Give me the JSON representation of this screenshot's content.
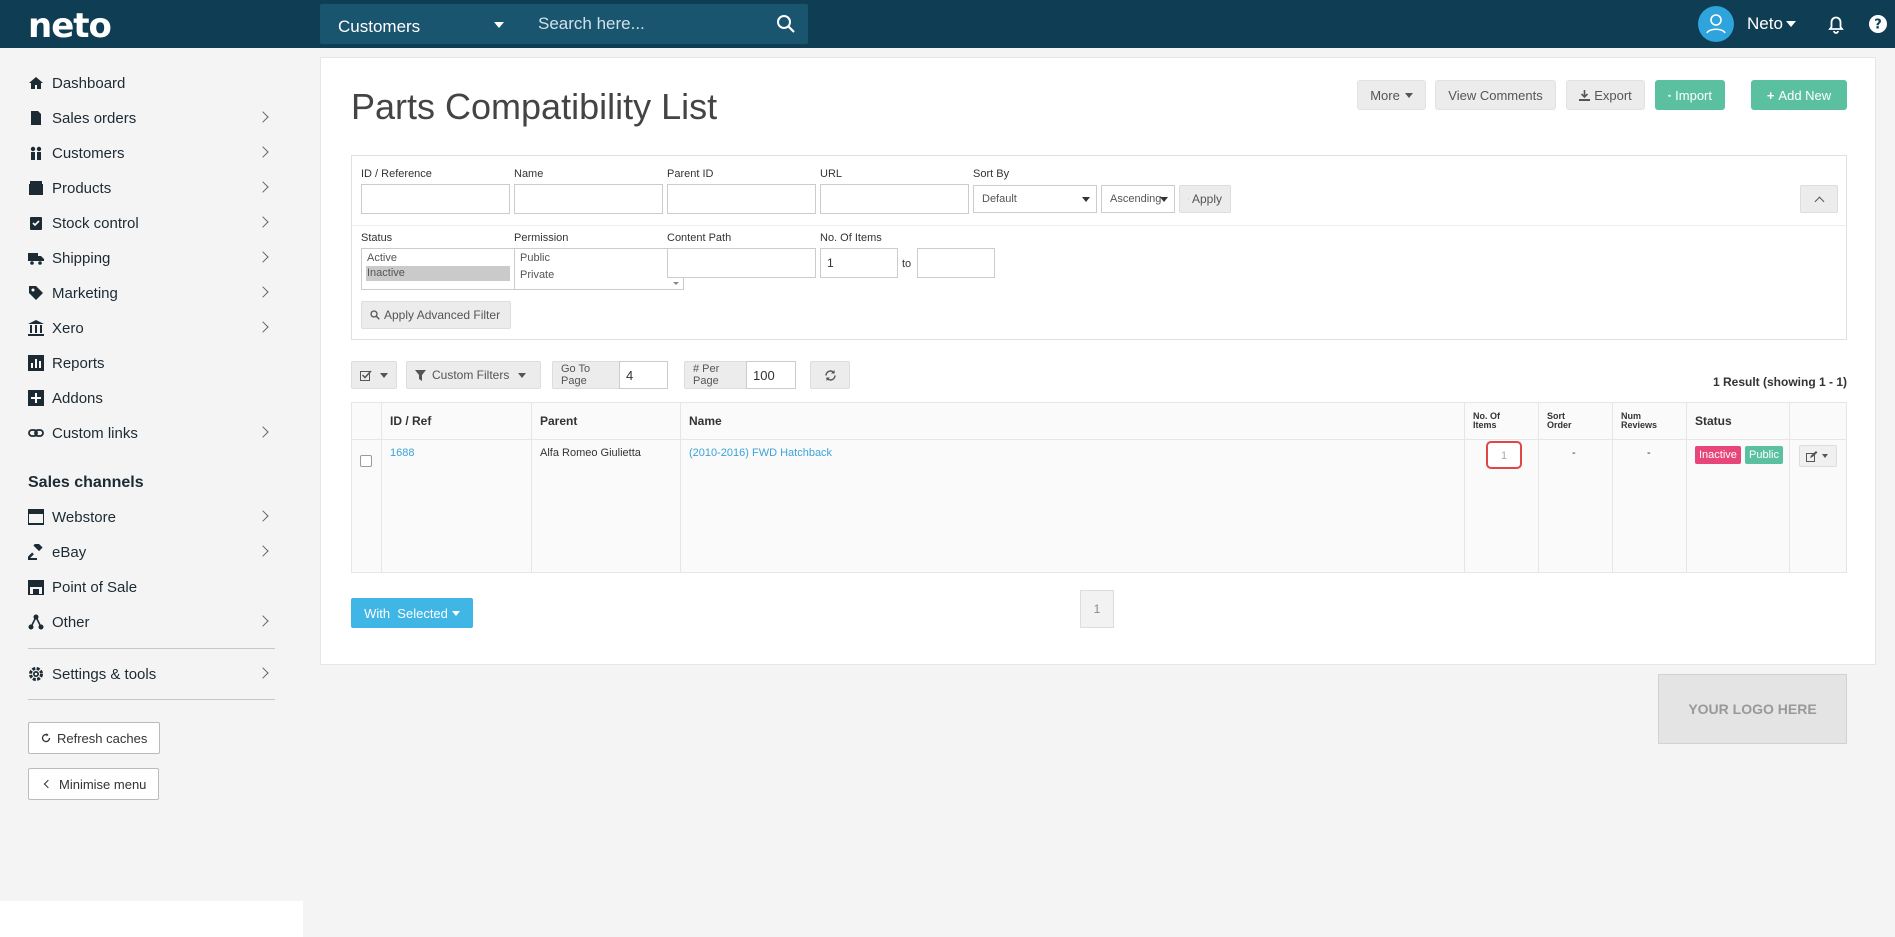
{
  "topbar": {
    "logo": "neto",
    "search_scope": "Customers",
    "search_placeholder": "Search here...",
    "user_name": "Neto"
  },
  "sidebar": {
    "items": [
      {
        "label": "Dashboard",
        "icon": "home-icon"
      },
      {
        "label": "Sales orders",
        "icon": "document-icon"
      },
      {
        "label": "Customers",
        "icon": "people-icon"
      },
      {
        "label": "Products",
        "icon": "box-icon"
      },
      {
        "label": "Stock control",
        "icon": "clipboard-icon"
      },
      {
        "label": "Shipping",
        "icon": "truck-icon"
      },
      {
        "label": "Marketing",
        "icon": "tag-icon"
      },
      {
        "label": "Xero",
        "icon": "bank-icon"
      },
      {
        "label": "Reports",
        "icon": "chart-icon"
      },
      {
        "label": "Addons",
        "icon": "plus-square-icon"
      },
      {
        "label": "Custom links",
        "icon": "link-icon"
      }
    ],
    "sales_channels_heading": "Sales channels",
    "channels": [
      {
        "label": "Webstore",
        "icon": "browser-icon"
      },
      {
        "label": "eBay",
        "icon": "gavel-icon"
      },
      {
        "label": "Point of Sale",
        "icon": "store-icon"
      },
      {
        "label": "Other",
        "icon": "network-icon"
      }
    ],
    "settings_label": "Settings & tools",
    "refresh_caches": "Refresh caches",
    "minimise_menu": "Minimise menu"
  },
  "page": {
    "title": "Parts Compatibility List",
    "toolbar": {
      "more": "More",
      "view_comments": "View Comments",
      "export": "Export",
      "import": "Import",
      "add_new": "Add New"
    }
  },
  "filters": {
    "id_label": "ID / Reference",
    "name_label": "Name",
    "parent_id_label": "Parent ID",
    "url_label": "URL",
    "sort_by_label": "Sort By",
    "sort_by_value": "Default",
    "sort_dir_value": "Ascending",
    "apply": "Apply",
    "status_label": "Status",
    "status_options": [
      "Active",
      "Inactive"
    ],
    "permission_label": "Permission",
    "permission_options": [
      "Public",
      "Private"
    ],
    "content_path_label": "Content Path",
    "no_items_label": "No. Of Items",
    "no_items_from": "1",
    "to_label": "to",
    "apply_advanced": "Apply Advanced Filter"
  },
  "controls": {
    "custom_filters": "Custom Filters",
    "go_to_page_label": "Go To Page",
    "go_to_page_value": "4",
    "per_page_label": "# Per Page",
    "per_page_value": "100",
    "result_count": "1 Result (showing 1 - 1)"
  },
  "table": {
    "headers": {
      "id": "ID / Ref",
      "parent": "Parent",
      "name": "Name",
      "no_items_line1": "No. Of",
      "no_items_line2": "Items",
      "sort_order_line1": "Sort",
      "sort_order_line2": "Order",
      "num_reviews_line1": "Num",
      "num_reviews_line2": "Reviews",
      "status": "Status"
    },
    "rows": [
      {
        "id": "1688",
        "parent": "Alfa Romeo Giulietta",
        "name": "(2010-2016) FWD Hatchback",
        "no_items": "1",
        "sort_order": "-",
        "num_reviews": "-",
        "status": "Inactive",
        "permission": "Public"
      }
    ]
  },
  "footer": {
    "with_selected": "With  Selected",
    "page_number": "1",
    "logo_placeholder": "YOUR LOGO HERE"
  },
  "colors": {
    "topbar": "#0f3d53",
    "accent_green": "#5bc0a0",
    "accent_blue": "#3fb6e6",
    "link": "#3ba3d8",
    "inactive_badge": "#e8457a",
    "public_badge": "#5bc0a0"
  }
}
